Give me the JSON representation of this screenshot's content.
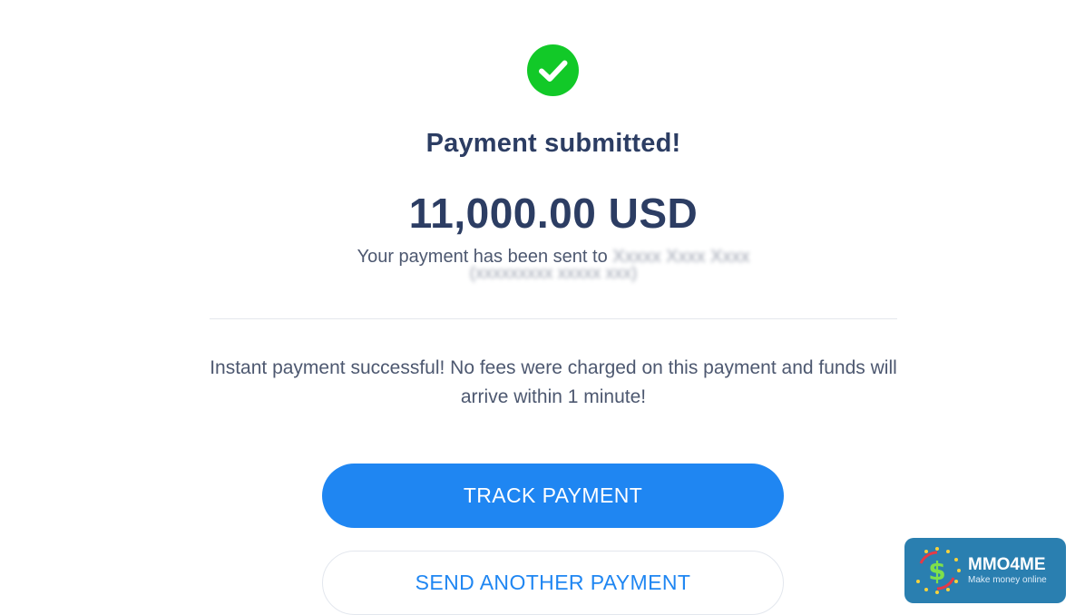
{
  "confirmation": {
    "icon": "check-circle-icon",
    "title": "Payment submitted!",
    "amount": "11,000.00 USD",
    "sent_to_prefix": "Your payment has been sent to",
    "instant_message": "Instant payment successful! No fees were charged on this payment and funds will arrive within 1 minute!"
  },
  "actions": {
    "track_label": "TRACK PAYMENT",
    "send_another_label": "SEND ANOTHER PAYMENT"
  },
  "watermark": {
    "brand": "MMO4ME",
    "tagline": "Make money online"
  },
  "colors": {
    "success": "#12c928",
    "accent": "#1f86f2",
    "heading": "#2c3d63",
    "body_text": "#4d5870"
  }
}
